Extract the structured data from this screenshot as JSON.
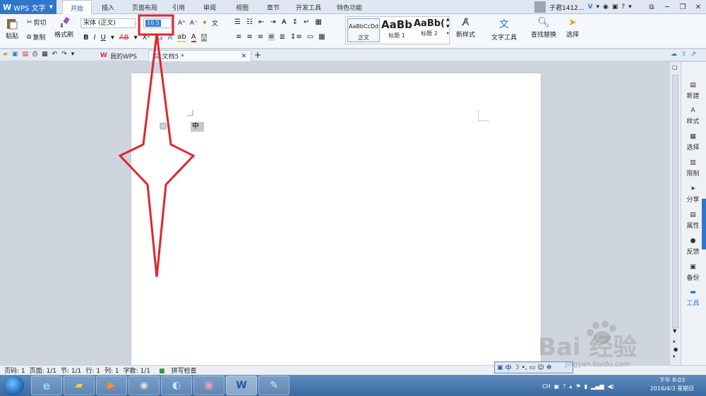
{
  "app": {
    "name": "WPS 文字"
  },
  "menu": {
    "tabs": [
      "开始",
      "插入",
      "页面布局",
      "引用",
      "审阅",
      "视图",
      "章节",
      "开发工具",
      "特色功能"
    ],
    "active_tab": "开始",
    "user": "子君1412..."
  },
  "ribbon": {
    "paste": "粘贴",
    "cut": "剪切",
    "copy": "复制",
    "format_painter": "格式刷",
    "font_name": "宋体 (正文)",
    "font_size": "10.5",
    "styles": [
      {
        "sample": "AaBbCcDd",
        "label": "正文"
      },
      {
        "sample": "AaBb",
        "label": "标题 1"
      },
      {
        "sample": "AaBb(",
        "label": "标题 2"
      }
    ],
    "new_style": "新样式",
    "text_tools": "文字工具",
    "find_replace": "查找替换",
    "select": "选择"
  },
  "doc_tabs": [
    {
      "label": "我的WPS"
    },
    {
      "label": "文档5 *"
    }
  ],
  "document": {
    "text": "中"
  },
  "sidebar": {
    "items": [
      "新建",
      "样式",
      "选择",
      "限制",
      "分享",
      "属性",
      "反馈",
      "备份",
      "工具"
    ]
  },
  "status": {
    "page_num": "页码: 1",
    "pages": "页面: 1/1",
    "section": "节: 1/1",
    "row": "行: 1",
    "col": "列: 1",
    "words": "字数: 1/1",
    "spell": "拼写检查"
  },
  "ime": {
    "mode": "中"
  },
  "taskbar": {
    "lang": "CH",
    "time": "下午 8:03",
    "date": "2016/4/3 星期日"
  },
  "watermark": {
    "brand": "Bai 经验",
    "url": "jingyan.baidu.com"
  },
  "colors": {
    "accent": "#2f76cc",
    "annotation": "#e0262a"
  }
}
